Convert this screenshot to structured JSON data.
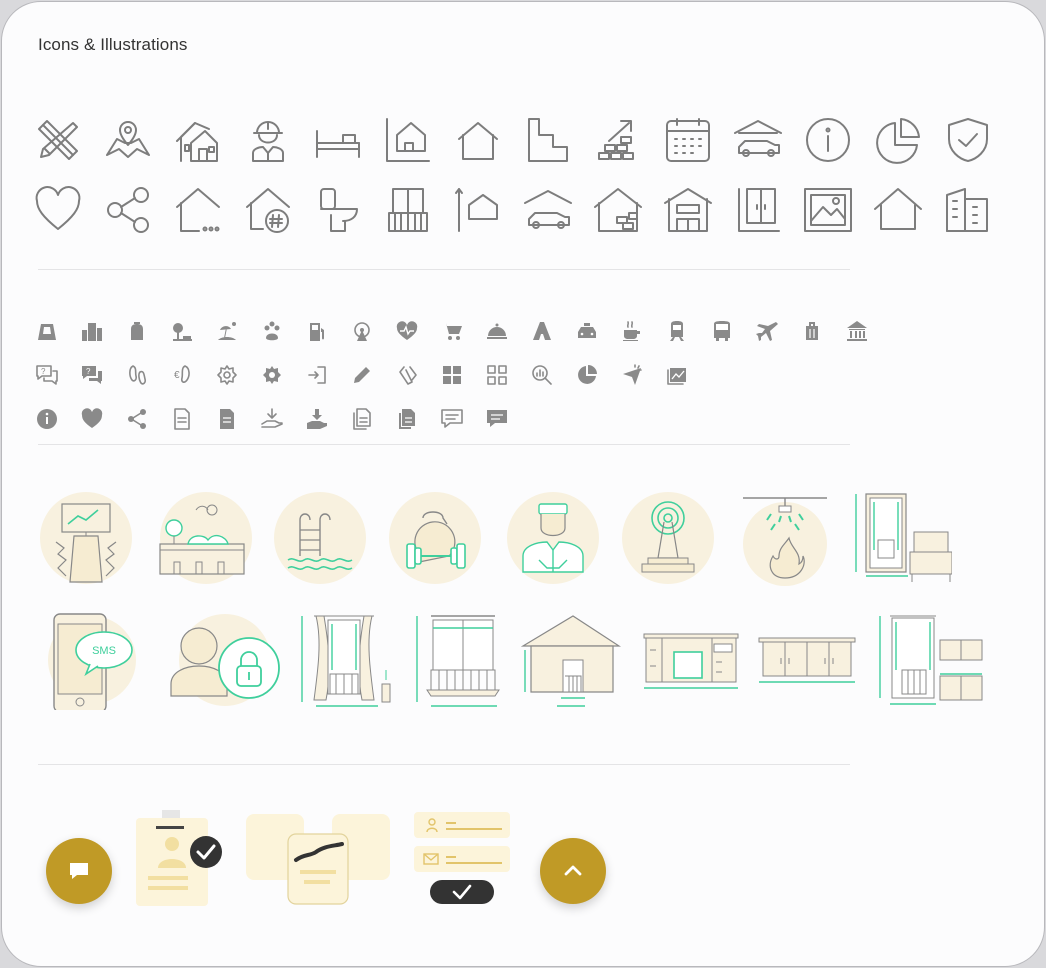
{
  "page": {
    "title": "Icons & Illustrations"
  },
  "icons_large_row1": [
    "tools-icon",
    "map-location-icon",
    "houses-icon",
    "worker-icon",
    "bed-icon",
    "house-area-icon",
    "house-outline-icon",
    "floor-plan-icon",
    "bricks-icon",
    "calendar-icon",
    "garage-car-icon",
    "info-icon",
    "pie-chart-icon",
    "shield-check-icon"
  ],
  "icons_large_row2": [
    "heart-icon",
    "share-icon",
    "house-more-icon",
    "house-number-icon",
    "toilet-icon",
    "balcony-icon",
    "house-height-icon",
    "carport-icon",
    "garage-storage-icon",
    "house-front-icon",
    "wardrobe-icon",
    "window-view-icon",
    "home-icon",
    "building-icon"
  ],
  "icons_small_row1": [
    "stadium-icon",
    "city-icon",
    "backpack-icon",
    "park-icon",
    "beach-icon",
    "pets-icon",
    "gas-station-icon",
    "ferris-wheel-icon",
    "health-icon",
    "cart-icon",
    "restaurant-icon",
    "road-icon",
    "taxi-icon",
    "coffee-icon",
    "train-icon",
    "bus-icon",
    "airplane-icon",
    "luggage-icon",
    "bank-icon"
  ],
  "icons_small_row2": [
    "help-chat-outline-icon",
    "help-chat-solid-icon",
    "footprint-outline-icon",
    "footprint-euro-icon",
    "settings-outline-icon",
    "settings-solid-icon",
    "login-icon",
    "pencil-icon",
    "attachments-icon",
    "grid-solid-icon",
    "grid-outline-icon",
    "search-chart-icon",
    "pie-solid-icon",
    "cursor-click-icon",
    "gallery-icon"
  ],
  "icons_small_row3": [
    "info-solid-icon",
    "heart-solid-icon",
    "share-solid-icon",
    "document-outline-icon",
    "document-solid-icon",
    "download-hand-outline-icon",
    "download-hand-solid-icon",
    "documents-outline-icon",
    "documents-solid-icon",
    "comment-outline-icon",
    "comment-solid-icon"
  ],
  "illustrations": {
    "sms_label": "SMS"
  },
  "fabs": {
    "chat": "chat-icon",
    "top": "chevron-up-icon"
  },
  "colors": {
    "accent": "#c09a26",
    "mint": "#3fcf9c",
    "cream": "#f8f1df",
    "icon_gray": "#7d7d7d"
  }
}
